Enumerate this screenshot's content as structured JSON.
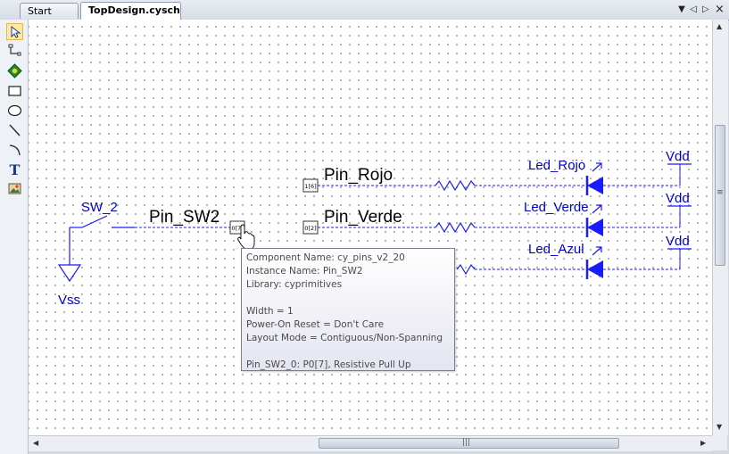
{
  "tabs": [
    {
      "label": "Start Page",
      "active": false
    },
    {
      "label": "TopDesign.cysch",
      "active": true
    }
  ],
  "tab_controls": {
    "dropdown": "▼",
    "prev": "◁",
    "next": "▷",
    "close": "×"
  },
  "toolbox": [
    "pointer-tool",
    "wire-tool",
    "component-tool",
    "rectangle-tool",
    "ellipse-tool",
    "line-tool",
    "arc-tool",
    "text-tool",
    "image-tool"
  ],
  "schematic": {
    "pins": {
      "rojo": "Pin_Rojo",
      "verde": "Pin_Verde",
      "sw2": "Pin_SW2"
    },
    "pin_ports": {
      "rojo": "1[6]",
      "verde": "0[2]",
      "sw2": "0[7]"
    },
    "leds": {
      "rojo": "Led_Rojo",
      "verde": "Led_Verde",
      "azul": "Led_Azul"
    },
    "vdd": [
      "Vdd",
      "Vdd",
      "Vdd"
    ],
    "switch": "SW_2",
    "ground": "Vss"
  },
  "tooltip": {
    "component": "Component Name: cy_pins_v2_20",
    "instance": "Instance Name: Pin_SW2",
    "library": "Library: cyprimitives",
    "width": "Width = 1",
    "reset": "Power-On Reset = Don't Care",
    "layout": "Layout Mode = Contiguous/Non-Spanning",
    "mapping": "Pin_SW2_0: P0[7], Resistive Pull Up"
  },
  "scroll": {
    "grip": "≡",
    "hgrip": "|||"
  },
  "colors": {
    "wire": "#1a1aff",
    "schematic_text": "#0000cc",
    "pin_text": "#000000"
  }
}
